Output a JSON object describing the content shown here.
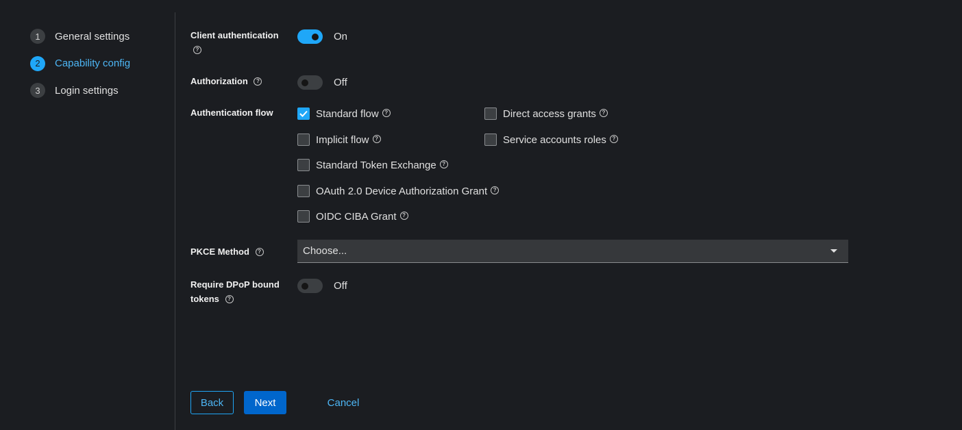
{
  "wizard": {
    "steps": [
      {
        "num": "1",
        "label": "General settings"
      },
      {
        "num": "2",
        "label": "Capability config"
      },
      {
        "num": "3",
        "label": "Login settings"
      }
    ]
  },
  "form": {
    "client_auth": {
      "label": "Client authentication",
      "state": "On"
    },
    "authorization": {
      "label": "Authorization",
      "state": "Off"
    },
    "auth_flow": {
      "label": "Authentication flow",
      "options": {
        "standard_flow": "Standard flow",
        "direct_access": "Direct access grants",
        "implicit_flow": "Implicit flow",
        "service_accounts": "Service accounts roles",
        "token_exchange": "Standard Token Exchange",
        "device_grant": "OAuth 2.0 Device Authorization Grant",
        "ciba_grant": "OIDC CIBA Grant"
      }
    },
    "pkce": {
      "label": "PKCE Method",
      "value": "Choose..."
    },
    "dpop": {
      "label_line1": "Require DPoP bound",
      "label_line2": "tokens",
      "state": "Off"
    }
  },
  "help_glyph": "?",
  "actions": {
    "back": "Back",
    "next": "Next",
    "cancel": "Cancel"
  },
  "colors": {
    "accent": "#1fa7f8",
    "primary_button": "#0066cc",
    "background": "#1b1d21"
  }
}
